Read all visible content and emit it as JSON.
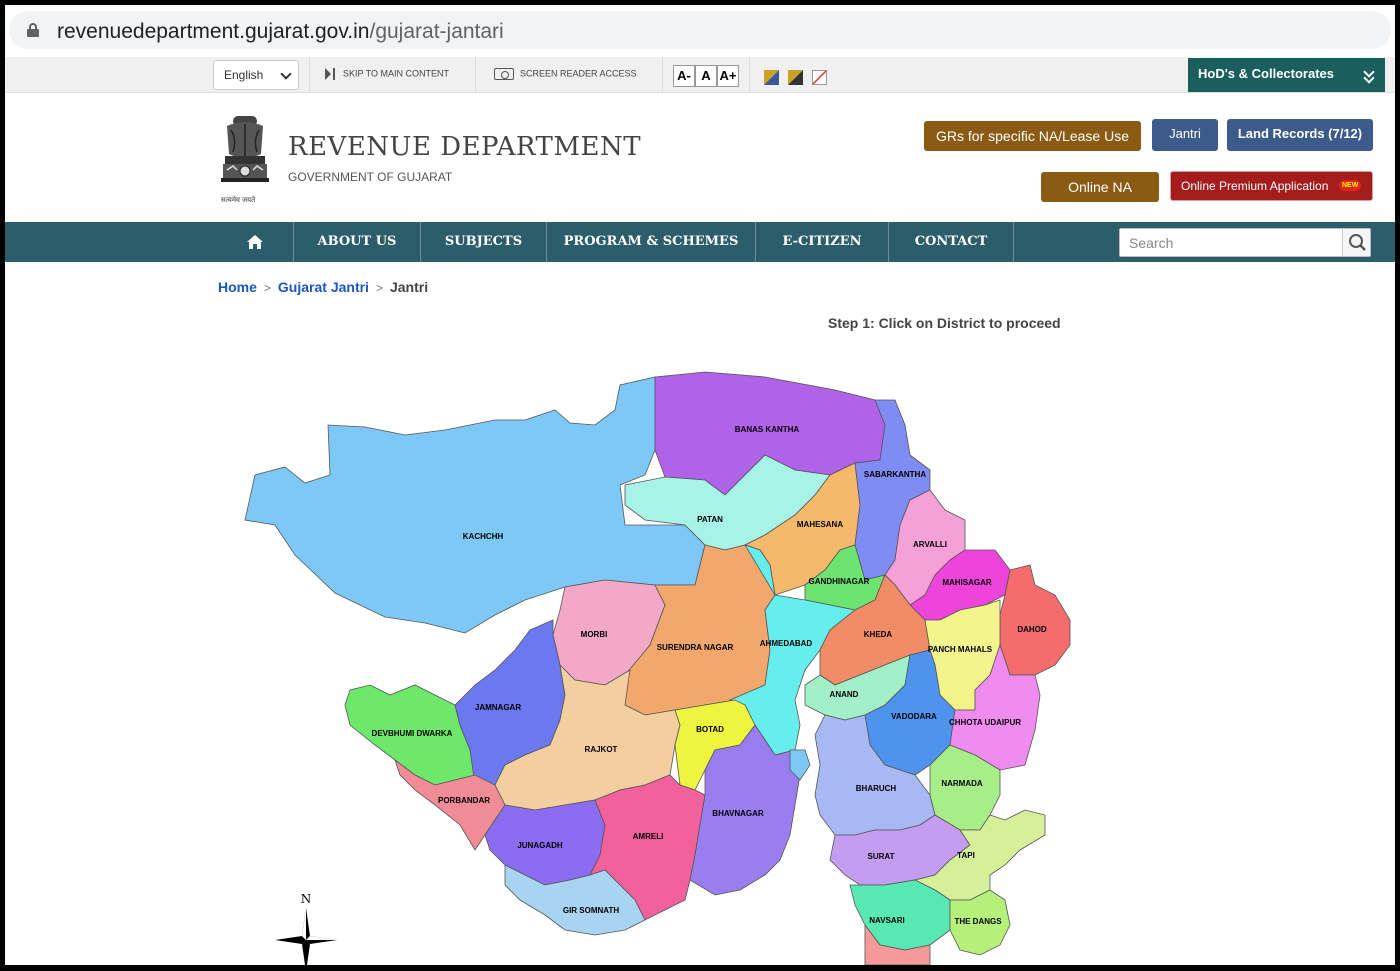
{
  "browser": {
    "url_domain": "revenuedepartment.gujarat.gov.in",
    "url_path": "/gujarat-jantari"
  },
  "utility_bar": {
    "language": "English",
    "skip_label": "SKIP TO MAIN CONTENT",
    "screen_reader_label": "SCREEN READER ACCESS",
    "font_decrease": "A-",
    "font_normal": "A",
    "font_increase": "A+",
    "hod_label": "HoD's & Collectorates"
  },
  "header": {
    "title": "REVENUE DEPARTMENT",
    "subtitle": "GOVERNMENT OF GUJARAT",
    "emblem_caption": "सत्यमेव जयते",
    "buttons": {
      "grs": "GRs for specific NA/Lease Use",
      "jantri": "Jantri",
      "land_records": "Land Records (7/12)",
      "online_na": "Online NA",
      "premium": "Online Premium Application",
      "new_badge": "NEW"
    },
    "colors": {
      "brown": "#8b5a13",
      "blue": "#3c5b8a",
      "red": "#a51c1c",
      "nav": "#2b5d6b"
    }
  },
  "nav": {
    "items": [
      "ABOUT US",
      "SUBJECTS",
      "PROGRAM & SCHEMES",
      "E-CITIZEN",
      "CONTACT"
    ],
    "search_placeholder": "Search"
  },
  "breadcrumb": {
    "home": "Home",
    "parent": "Gujarat Jantri",
    "current": "Jantri"
  },
  "step_text": "Step 1: Click on District to proceed",
  "map": {
    "compass": "N",
    "districts": [
      "KACHCHH",
      "BANAS KANTHA",
      "PATAN",
      "MAHESANA",
      "SABARKANTHA",
      "ARVALLI",
      "GANDHINAGAR",
      "MAHISAGAR",
      "DAHOD",
      "MORBI",
      "SURENDRA NAGAR",
      "AHMEDABAD",
      "KHEDA",
      "PANCH MAHALS",
      "ANAND",
      "VADODARA",
      "CHHOTA UDAIPUR",
      "JAMNAGAR",
      "DEVBHUMI DWARKA",
      "RAJKOT",
      "BOTAD",
      "PORBANDAR",
      "JUNAGADH",
      "AMRELI",
      "BHAVNAGAR",
      "BHARUCH",
      "NARMADA",
      "SURAT",
      "TAPI",
      "GIR SOMNATH",
      "NAVSARI",
      "THE DANGS"
    ]
  }
}
